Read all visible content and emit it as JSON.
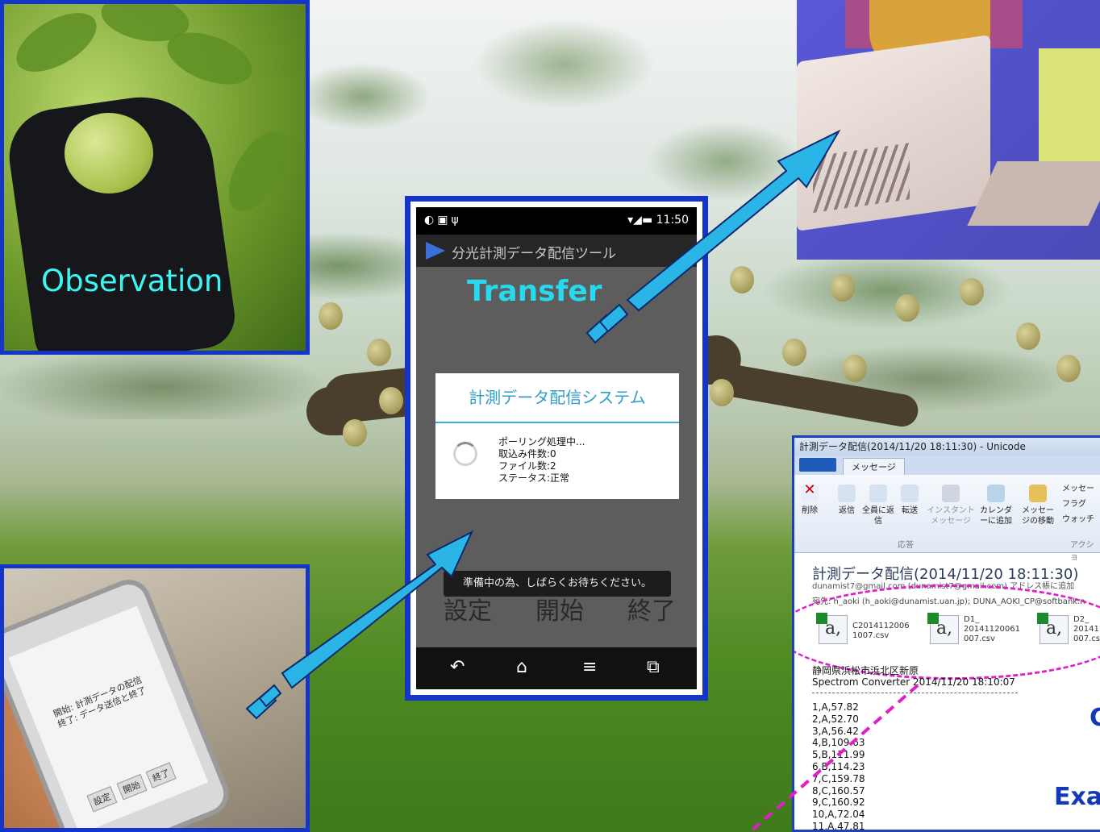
{
  "observation": {
    "label": "Observation"
  },
  "phone": {
    "status_time": "11:50",
    "app_title": "分光計測データ配信ツール",
    "overlay_label": "Transfer",
    "dialog_title": "計測データ配信システム",
    "dialog_lines": [
      "ポーリング処理中...",
      "取込み件数:0",
      "ファイル数:2",
      "ステータス:正常"
    ],
    "toast": "準備中の為、しばらくお待ちください。",
    "buttons": [
      "設定",
      "開始",
      "終了"
    ]
  },
  "phone_photo": {
    "screen_lines": [
      "開始: 計測データの配信",
      "終了: データ送信と終了"
    ],
    "buttons": [
      "設定",
      "開始",
      "終了"
    ]
  },
  "email": {
    "window_title": "計測データ配信(2014/11/20 18:11:30) - Unicode",
    "tab": "メッセージ",
    "ribbon": {
      "delete": "削除",
      "reply": "返信",
      "reply_all": "全員に返信",
      "forward": "転送",
      "instant": "インスタントメッセージ",
      "calendar": "カレンダーに追加",
      "move": "メッセージの移動",
      "right_items": [
        "メッセー",
        "フラグ",
        "ウォッチ"
      ],
      "group_reply": "応答",
      "group_action": "アクショ"
    },
    "subject": "計測データ配信(2014/11/20 18:11:30)",
    "from": "dunamist7@gmail.com (dunamist7@gmail.com)  アドレス帳に追加",
    "to": "宛先: h_aoki (h_aoki@dunamist.uan.jp); DUNA_AOKI_CP@softbank.n",
    "attachments": [
      {
        "name": "C2014112006\n1007.csv"
      },
      {
        "name": "D1_\n20141120061\n007.csv"
      },
      {
        "name": "D2_\n201411\n007.cs"
      }
    ],
    "location": "静岡県浜松市浜北区新原",
    "converter": "Spectrom Converter 2014/11/20 18:10:07",
    "data_rows": [
      "1,A,57.82",
      "2,A,52.70",
      "3,A,56.42",
      "4,B,109.63",
      "5,B,111.99",
      "6,B,114.23",
      "7,C,159.78",
      "8,C,160.57",
      "9,C,160.92",
      "10,A,72.04",
      "11,A,47.81"
    ],
    "side_label_1": "C",
    "side_label_2": "Exa"
  },
  "colors": {
    "panel_border": "#1535c8",
    "arrow": "#2bb5e6",
    "dash": "#e01fc9",
    "label_cyan": "#3cf6f6"
  }
}
